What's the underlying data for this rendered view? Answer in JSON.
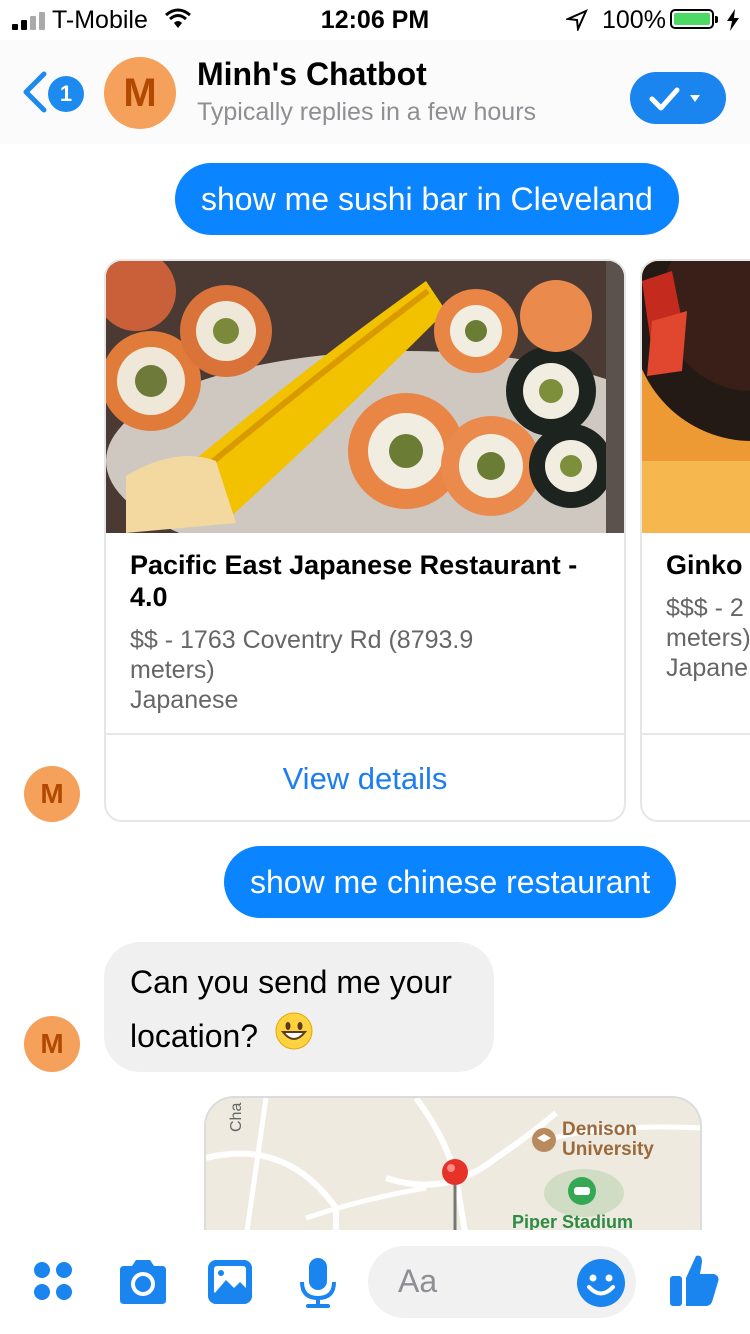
{
  "status_bar": {
    "carrier": "T-Mobile",
    "time": "12:06 PM",
    "battery": "100%"
  },
  "header": {
    "back_badge": "1",
    "avatar_letter": "M",
    "name": "Minh's Chatbot",
    "subtitle": "Typically replies in a few hours",
    "action_icon": "checkmark-dropdown-icon"
  },
  "messages": {
    "m1": "show me sushi bar in Cleveland",
    "m2": "show me chinese restaurant",
    "m3_line1": "Can you send me your",
    "m3_line2": "location?",
    "avatar_letter": "M"
  },
  "cards": [
    {
      "title_line1": "Pacific East Japanese Restaurant -",
      "title_line2": "4.0",
      "meta_line1": "$$ - 1763 Coventry Rd (8793.9",
      "meta_line2": "meters)",
      "meta_line3": "Japanese",
      "button": "View details"
    },
    {
      "title_line1": "Ginko",
      "meta_line1": "$$$ - 2",
      "meta_line2": "meters)",
      "meta_line3": "Japane"
    }
  ],
  "map": {
    "road_label": "Cha",
    "place1_line1": "Denison",
    "place1_line2": "University",
    "place2": "Piper Stadium"
  },
  "composer": {
    "placeholder": "Aa"
  },
  "colors": {
    "messenger_blue": "#0a84ff",
    "avatar_orange": "#f5a05b",
    "bubble_gray": "#f0f0f0"
  }
}
